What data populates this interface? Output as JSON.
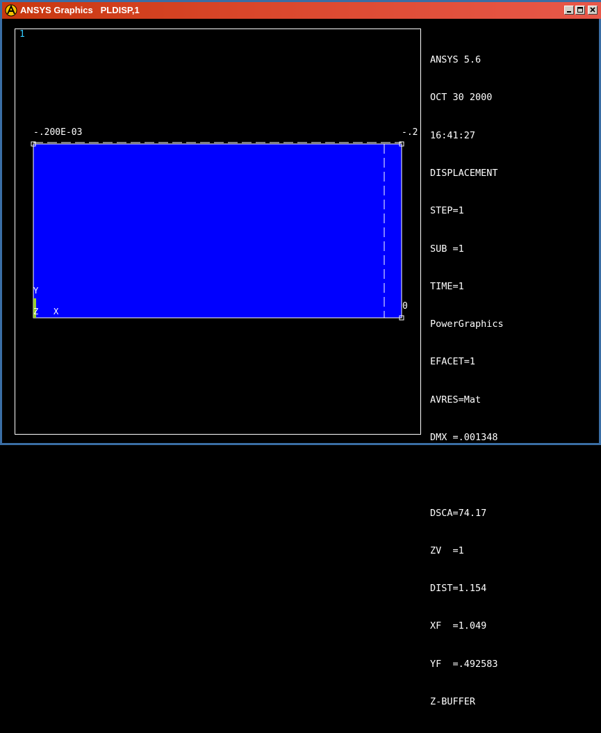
{
  "window": {
    "title": "ANSYS Graphics   PLDISP,1",
    "icon": "ansys-logo-icon",
    "controls": [
      "minimize-icon",
      "maximize-icon",
      "close-icon"
    ]
  },
  "viewport": {
    "window_number": "1",
    "label_left": "-.200E-03",
    "label_right": "-.2",
    "label_zero": "0",
    "triad": {
      "x": "X",
      "y": "Y",
      "z": "Z"
    },
    "fill_color": "#0000ff",
    "outline_color": "#ffffff"
  },
  "legend": {
    "lines": [
      "ANSYS 5.6",
      "OCT 30 2000",
      "16:41:27",
      "DISPLACEMENT",
      "STEP=1",
      "SUB =1",
      "TIME=1",
      "PowerGraphics",
      "EFACET=1",
      "AVRES=Mat",
      "DMX =.001348",
      "",
      "DSCA=74.17",
      "ZV  =1",
      "DIST=1.154",
      "XF  =1.049",
      "YF  =.492583",
      "Z-BUFFER"
    ]
  }
}
